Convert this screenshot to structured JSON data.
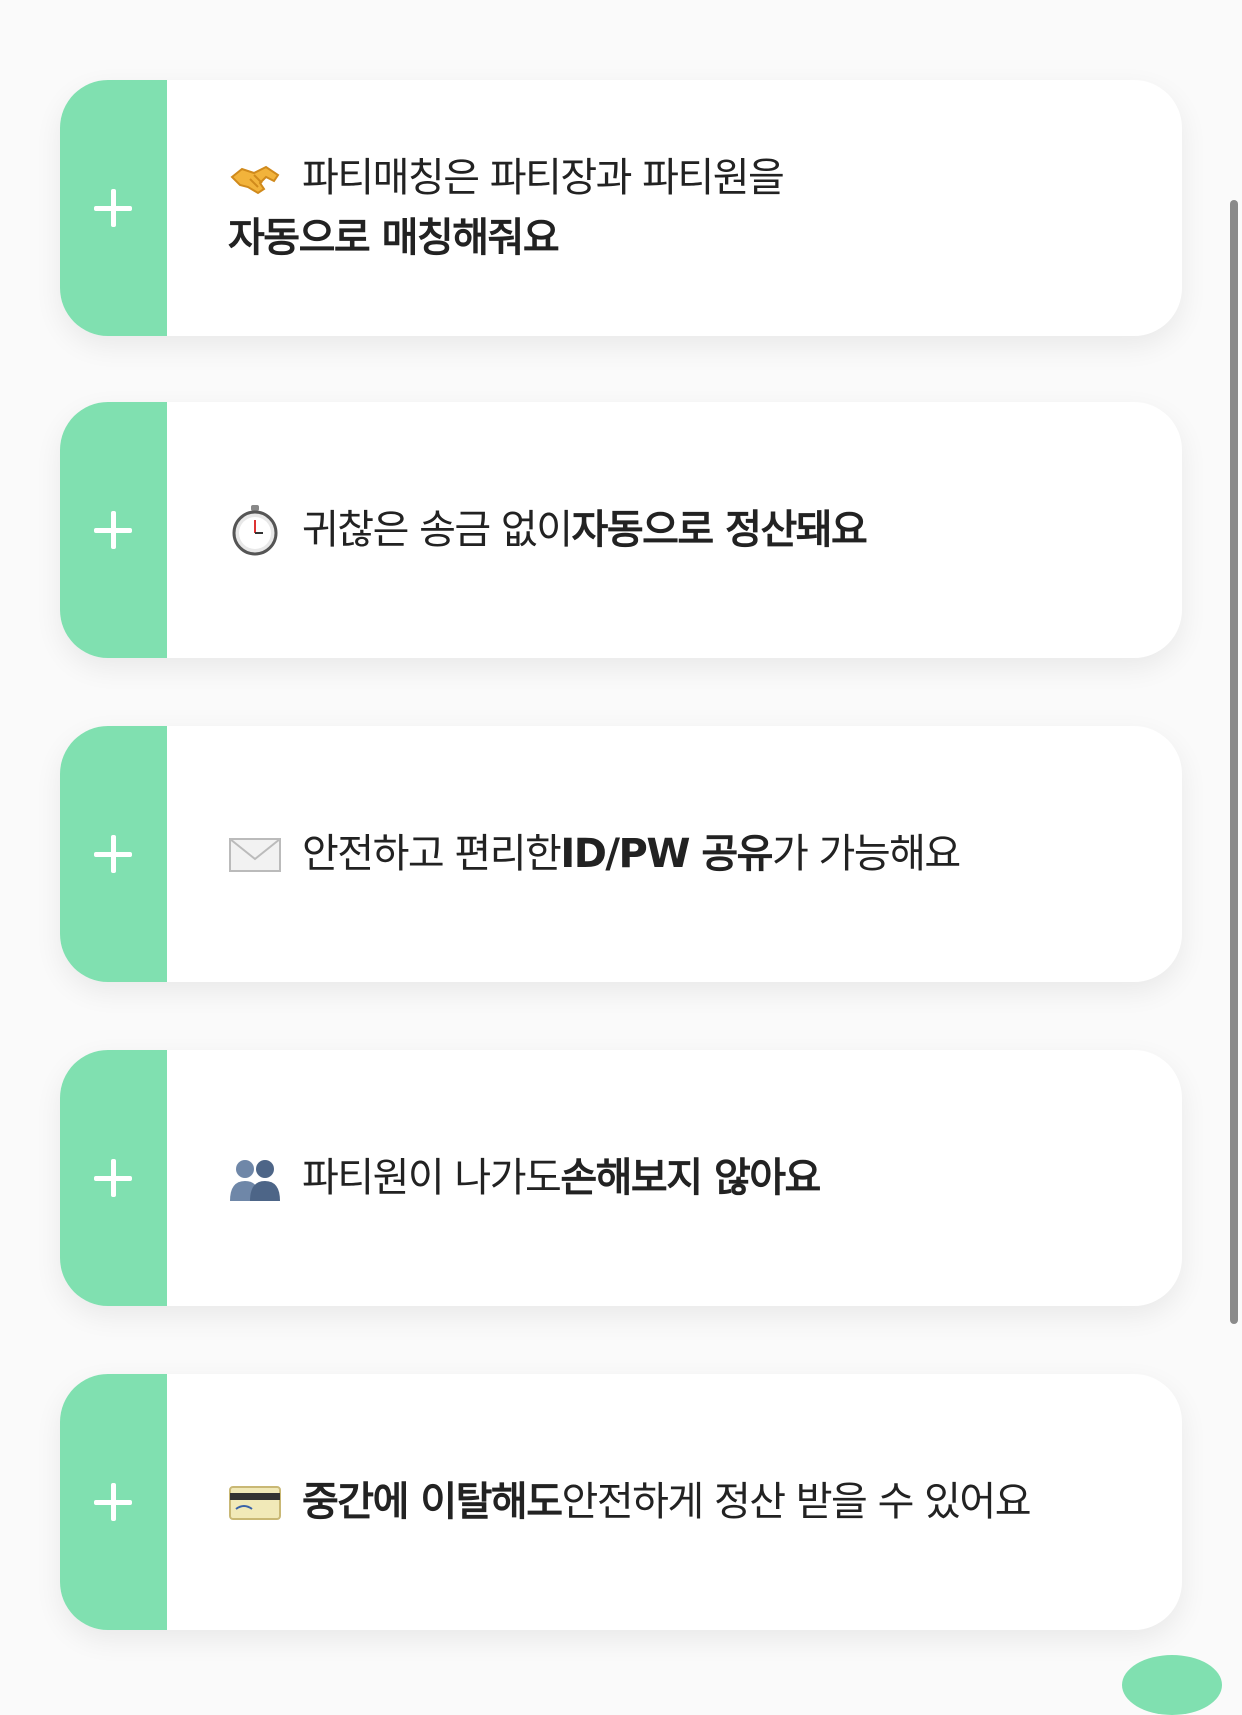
{
  "colors": {
    "accent": "#80e0b0",
    "card": "#ffffff",
    "background": "#fafafa",
    "text": "#222222"
  },
  "features": [
    {
      "icon": "handshake-icon",
      "emoji": "🤝",
      "line1": "파티매칭은 파티장과 파티원을",
      "line2": "자동으로 매칭해줘요"
    },
    {
      "icon": "stopwatch-icon",
      "emoji": "⏱️",
      "regular1": "귀찮은 송금 없이 ",
      "bold1": "자동으로 정산돼요"
    },
    {
      "icon": "envelope-icon",
      "emoji": "✉️",
      "regular1": "안전하고 편리한 ",
      "bold1": "ID/PW 공유",
      "regular2": "가 가능해요"
    },
    {
      "icon": "people-icon",
      "emoji": "👥",
      "regular1": "파티원이 나가도 ",
      "bold1": "손해보지 않아요"
    },
    {
      "icon": "credit-card-icon",
      "emoji": "💳",
      "bold1": "중간에 이탈해도",
      "regular1": " 안전하게 정산 받을 수 있어요"
    }
  ]
}
